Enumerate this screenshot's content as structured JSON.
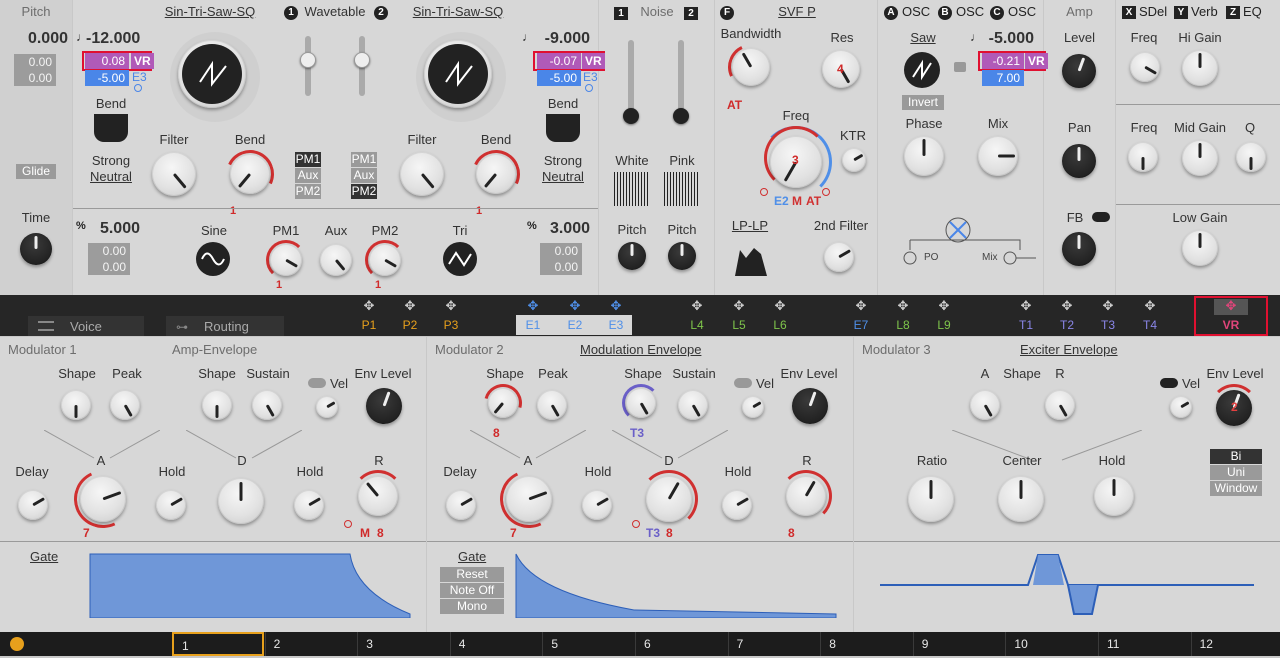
{
  "pitch": {
    "title": "Pitch",
    "value": "0.000",
    "v1": "0.00",
    "v2": "0.00",
    "glide": "Glide",
    "time": "Time"
  },
  "wt": {
    "osc1": "Sin-Tri-Saw-SQ",
    "header": "Wavetable",
    "n1": "1",
    "n2": "2",
    "osc2": "Sin-Tri-Saw-SQ",
    "o1_pitch": "-12.000",
    "o1_vr": "0.08",
    "o1_blue": "-5.00",
    "o1_e": "E3",
    "o1_vrtag": "VR",
    "o2_pitch": "-9.000",
    "o2_vr": "-0.07",
    "o2_blue": "-5.00",
    "o2_e": "E3",
    "o2_vrtag": "VR",
    "bend": "Bend",
    "strong": "Strong",
    "neutral": "Neutral",
    "filter": "Filter",
    "bendk": "Bend",
    "one": "1",
    "pm1": "PM1",
    "aux": "Aux",
    "pm2": "PM2",
    "left_pct": "5.000",
    "l1": "0.00",
    "l2": "0.00",
    "right_pct": "3.000",
    "r1": "0.00",
    "r2": "0.00",
    "sine": "Sine",
    "tri": "Tri",
    "pm1k": "PM1",
    "auxk": "Aux",
    "pm2k": "PM2",
    "pct": "%"
  },
  "noise": {
    "n1": "1",
    "n2": "2",
    "title": "Noise",
    "white": "White",
    "pink": "Pink",
    "pitch": "Pitch"
  },
  "svf": {
    "tag": "F",
    "title": "SVF P",
    "bandwidth": "Bandwidth",
    "res": "Res",
    "res_val": "4",
    "at": "AT",
    "freq": "Freq",
    "freq_val": "3",
    "ktr": "KTR",
    "e2": "E2",
    "m": "M",
    "at2": "AT",
    "lplp": "LP-LP",
    "filter2": "2nd Filter"
  },
  "osc": {
    "a": "A",
    "b": "B",
    "c": "C",
    "label": "OSC",
    "saw": "Saw",
    "pitch": "-5.000",
    "vr": "-0.21",
    "vrtag": "VR",
    "blue": "7.00",
    "invert": "Invert",
    "phase": "Phase",
    "mix": "Mix",
    "po": "PO",
    "mixl": "Mix"
  },
  "amp": {
    "title": "Amp",
    "level": "Level",
    "pan": "Pan",
    "fb": "FB"
  },
  "fx": {
    "x": "X",
    "sdel": "SDel",
    "y": "Y",
    "verb": "Verb",
    "z": "Z",
    "eq": "EQ",
    "freq": "Freq",
    "higain": "Hi Gain",
    "freq2": "Freq",
    "midgain": "Mid Gain",
    "q": "Q",
    "lowgain": "Low Gain"
  },
  "bar": {
    "voice": "Voice",
    "routing": "Routing",
    "slots": [
      {
        "t": "P1",
        "c": "#e7a01c"
      },
      {
        "t": "P2",
        "c": "#e7a01c"
      },
      {
        "t": "P3",
        "c": "#e7a01c"
      },
      {
        "t": "E1",
        "c": "#4f8fe8"
      },
      {
        "t": "E2",
        "c": "#4f8fe8"
      },
      {
        "t": "E3",
        "c": "#4f8fe8"
      },
      {
        "t": "L4",
        "c": "#7fc64b"
      },
      {
        "t": "L5",
        "c": "#7fc64b"
      },
      {
        "t": "L6",
        "c": "#7fc64b"
      },
      {
        "t": "E7",
        "c": "#4f8fe8"
      },
      {
        "t": "L8",
        "c": "#7fc64b"
      },
      {
        "t": "L9",
        "c": "#7fc64b"
      },
      {
        "t": "T1",
        "c": "#8a86e8"
      },
      {
        "t": "T2",
        "c": "#8a86e8"
      },
      {
        "t": "T3",
        "c": "#8a86e8"
      },
      {
        "t": "T4",
        "c": "#8a86e8"
      },
      {
        "t": "VR",
        "c": "#e0457a"
      }
    ]
  },
  "mod1": {
    "title": "Modulator 1",
    "amp": "Amp-Envelope",
    "shape": "Shape",
    "peak": "Peak",
    "shape2": "Shape",
    "sustain": "Sustain",
    "vel": "Vel",
    "envlevel": "Env Level",
    "a": "A",
    "d": "D",
    "delay": "Delay",
    "hold": "Hold",
    "hold2": "Hold",
    "r": "R",
    "seven": "7",
    "m": "M",
    "eight": "8",
    "gate": "Gate"
  },
  "mod2": {
    "title": "Modulator 2",
    "env": "Modulation Envelope",
    "shape": "Shape",
    "peak": "Peak",
    "shape2": "Shape",
    "sustain": "Sustain",
    "vel": "Vel",
    "envlevel": "Env Level",
    "a": "A",
    "d": "D",
    "delay": "Delay",
    "hold": "Hold",
    "hold2": "Hold",
    "r": "R",
    "eight": "8",
    "t3": "T3",
    "seven": "7",
    "t3b": "T3",
    "eightb": "8",
    "eightc": "8",
    "gate": "Gate",
    "reset": "Reset",
    "noteoff": "Note Off",
    "mono": "Mono"
  },
  "mod3": {
    "title": "Modulator 3",
    "env": "Exciter Envelope",
    "a": "A",
    "shape": "Shape",
    "r": "R",
    "vel": "Vel",
    "envlevel": "Env Level",
    "env_val": "2",
    "ratio": "Ratio",
    "center": "Center",
    "hold": "Hold",
    "bi": "Bi",
    "uni": "Uni",
    "window": "Window"
  },
  "footer": {
    "cells": [
      "1",
      "2",
      "3",
      "4",
      "5",
      "6",
      "7",
      "8",
      "9",
      "10",
      "11",
      "12"
    ]
  }
}
